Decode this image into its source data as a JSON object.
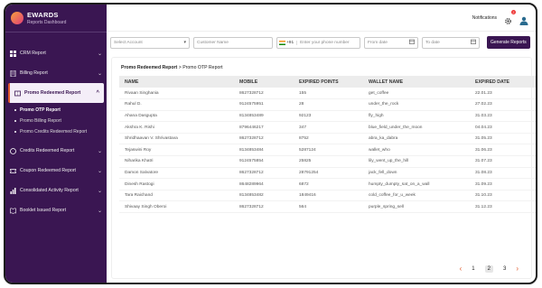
{
  "brand": {
    "name": "EWARDS",
    "subtitle": "Reports Dashboard"
  },
  "sidebar": {
    "items": [
      {
        "label": "CRM Report",
        "icon": "grid-icon",
        "chevron": "⌄"
      },
      {
        "label": "Billing Report",
        "icon": "receipt-icon",
        "chevron": "⌄"
      },
      {
        "label": "Promo Redeemed Report",
        "icon": "ticket-icon",
        "chevron": "^"
      },
      {
        "label": "Credits Redeemed Report",
        "icon": "credit-icon",
        "chevron": "⌄"
      },
      {
        "label": "Coupon Redeemed Report",
        "icon": "coupon-icon",
        "chevron": "⌄"
      },
      {
        "label": "Consolidated Activity Report",
        "icon": "chart-icon",
        "chevron": "⌄"
      },
      {
        "label": "Booklet Issued Report",
        "icon": "booklet-icon",
        "chevron": "⌄"
      }
    ],
    "sub_items": [
      "Promo OTP Report",
      "Promo Billing Report",
      "Promo Credits Redeemed Report"
    ]
  },
  "topbar": {
    "notifications_label": "Notifications",
    "badge_count": "2"
  },
  "filters": {
    "account_placeholder": "Select Account",
    "customer_placeholder": "Customer Name",
    "country_code": "+91",
    "phone_placeholder": "Enter your phone number",
    "from_placeholder": "From date",
    "to_placeholder": "To date",
    "generate_label": "Generate Reports"
  },
  "breadcrumb": {
    "parent": "Promo Redeemed Report",
    "separator": ">",
    "current": "Promo OTP Report"
  },
  "table": {
    "headers": [
      "NAME",
      "MOBILE",
      "EXPIRED POINTS",
      "WALLET NAME",
      "EXPIRED DATE"
    ],
    "rows": [
      [
        "Rivaan Singhania",
        "8627328712",
        "155",
        "get_coffee",
        "22.01.23"
      ],
      [
        "Rahul D.",
        "9124575951",
        "28",
        "under_the_rock",
        "27.02.23"
      ],
      [
        "Ahana Dasgupta",
        "8134853489",
        "92123",
        "fly_high",
        "31.03.23"
      ],
      [
        "Akshra K. Rishi",
        "8796446217",
        "347",
        "blue_field_under_the_moon",
        "04.04.23"
      ],
      [
        "Shridhaavan V. Shrivastava",
        "8627328712",
        "8752",
        "abra_ka_dabra",
        "31.05.23"
      ],
      [
        "Tejaswini Roy",
        "8134853484",
        "5287124",
        "wallet_who",
        "31.06.23"
      ],
      [
        "Niharika Khatri",
        "9124575854",
        "25825",
        "lily_went_up_the_hill",
        "31.07.23"
      ],
      [
        "Damon Salvatore",
        "8627328712",
        "28791254",
        "jack_fell_down",
        "31.08.23"
      ],
      [
        "Dinesh Rastogi",
        "8648289964",
        "6872",
        "humpty_dumpty_sat_on_a_wall",
        "31.09.23"
      ],
      [
        "Tara Raichand",
        "8134853482",
        "1849416",
        "cold_coffee_for_u_week",
        "31.10.23"
      ],
      [
        "Shivaay Singh Oberoi",
        "8627328712",
        "564",
        "purple_spring_sell",
        "31.12.23"
      ]
    ]
  },
  "pagination": {
    "prev": "‹",
    "pages": [
      "1",
      "2",
      "3"
    ],
    "current_index": 1,
    "next": "›"
  }
}
